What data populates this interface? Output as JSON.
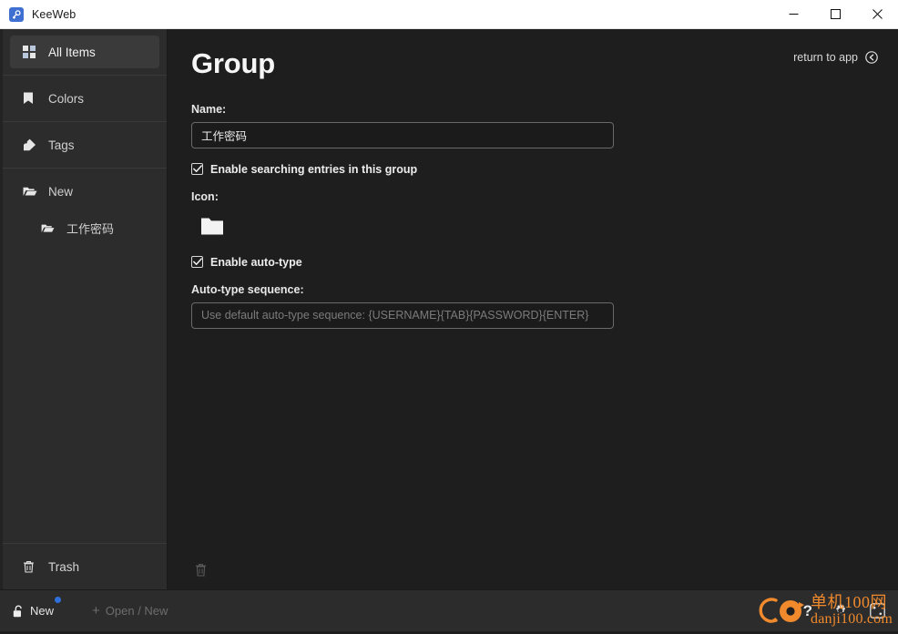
{
  "window": {
    "title": "KeeWeb",
    "app_icon": "key-icon",
    "controls": {
      "minimize": "minimize-icon",
      "maximize": "maximize-icon",
      "close": "close-icon"
    }
  },
  "sidebar": {
    "sections": [
      {
        "items": [
          {
            "label": "All Items",
            "icon": "grid-icon",
            "selected": true,
            "indent": false
          }
        ]
      },
      {
        "items": [
          {
            "label": "Colors",
            "icon": "bookmark-icon",
            "selected": false,
            "indent": false
          }
        ]
      },
      {
        "items": [
          {
            "label": "Tags",
            "icon": "tag-icon",
            "selected": false,
            "indent": false
          }
        ]
      },
      {
        "items": [
          {
            "label": "New",
            "icon": "folder-open-icon",
            "selected": false,
            "indent": false
          },
          {
            "label": "工作密码",
            "icon": "folder-open-icon",
            "selected": false,
            "indent": true
          }
        ]
      }
    ],
    "trash": {
      "label": "Trash",
      "icon": "trash-icon"
    }
  },
  "main": {
    "title": "Group",
    "return_link": {
      "label": "return to app",
      "icon": "arrow-left-circle-icon"
    },
    "name_field": {
      "label": "Name:",
      "value": "工作密码",
      "placeholder": ""
    },
    "search_checkbox": {
      "label": "Enable searching entries in this group",
      "checked": true
    },
    "icon_field": {
      "label": "Icon:",
      "selected_icon": "folder-icon"
    },
    "autotype_checkbox": {
      "label": "Enable auto-type",
      "checked": true
    },
    "autotype_sequence": {
      "label": "Auto-type sequence:",
      "value": "",
      "placeholder": "Use default auto-type sequence: {USERNAME}{TAB}{PASSWORD}{ENTER}"
    },
    "delete_button": {
      "icon": "trash-icon"
    }
  },
  "footer": {
    "file": {
      "label": "New",
      "icon": "lock-open-icon",
      "has_unsaved_badge": true
    },
    "open_new": {
      "label": "Open / New",
      "icon": "plus-icon"
    },
    "help": {
      "icon": "question-mark-icon"
    },
    "settings": {
      "icon": "gear-icon"
    },
    "generator": {
      "icon": "dice-icon"
    }
  },
  "watermark": {
    "line1": "单机100网",
    "line2": "danji100.com",
    "color": "#f08a2c"
  },
  "colors": {
    "titlebar_bg": "#ffffff",
    "sidebar_bg": "#2c2c2c",
    "main_bg": "#1e1e1e",
    "footer_bg": "#2c2c2c",
    "selected_item_bg": "#3a3a3a",
    "accent_blue": "#2f6fdc",
    "text_primary": "#ededed",
    "text_muted": "#7b7b7b"
  }
}
